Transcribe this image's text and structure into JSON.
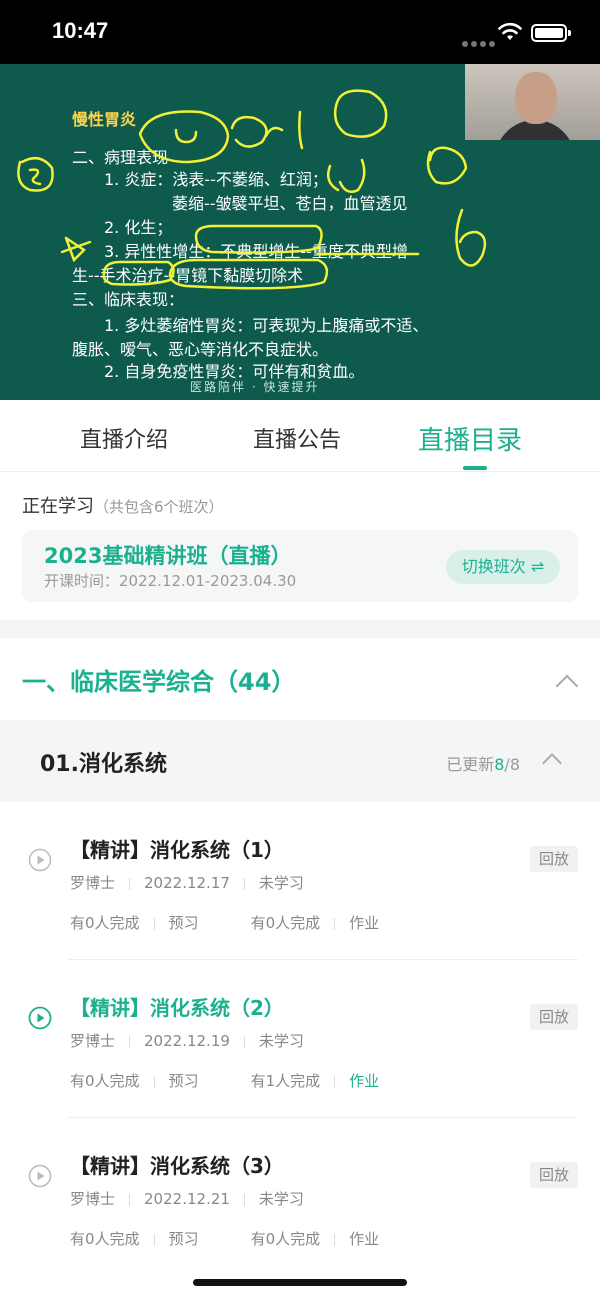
{
  "status_bar": {
    "time": "10:47"
  },
  "video": {
    "slide_title": "慢性胃炎",
    "lines": [
      "二、病理表现",
      "1. 炎症：浅表--不萎缩、红润；",
      "萎缩--皱襞平坦、苍白，血管透见",
      "2. 化生；",
      "3. 异性性增生：不典型增生--重度不典型增",
      "生--手术治疗--胃镜下黏膜切除术",
      "三、临床表现：",
      "1. 多灶萎缩性胃炎：可表现为上腹痛或不适、",
      "腹胀、嗳气、恶心等消化不良症状。",
      "2. 自身免疫性胃炎：可伴有和贫血。"
    ],
    "footer": "医路陪伴 · 快速提升"
  },
  "tabs": [
    {
      "label": "直播介绍"
    },
    {
      "label": "直播公告"
    },
    {
      "label": "直播目录"
    }
  ],
  "studying": {
    "label": "正在学习",
    "sub": "（共包含6个班次）",
    "class_name": "2023基础精讲班（直播）",
    "class_time": "开课时间：2022.12.01-2023.04.30",
    "switch_label": "切换班次 ⇌"
  },
  "chapter": {
    "title": "一、临床医学综合（44）"
  },
  "section": {
    "title": "01.消化系统",
    "updated_prefix": "已更新",
    "updated_count": "8",
    "updated_total": "/8"
  },
  "lessons": [
    {
      "title": "【精讲】消化系统（1）",
      "teacher": "罗博士",
      "date": "2022.12.17",
      "status": "未学习",
      "preview_count": "有0人完成",
      "preview_label": "预习",
      "hw_count": "有0人完成",
      "hw_label": "作业",
      "tag": "回放"
    },
    {
      "title": "【精讲】消化系统（2）",
      "teacher": "罗博士",
      "date": "2022.12.19",
      "status": "未学习",
      "preview_count": "有0人完成",
      "preview_label": "预习",
      "hw_count": "有1人完成",
      "hw_label": "作业",
      "tag": "回放"
    },
    {
      "title": "【精讲】消化系统（3）",
      "teacher": "罗博士",
      "date": "2022.12.21",
      "status": "未学习",
      "preview_count": "有0人完成",
      "preview_label": "预习",
      "hw_count": "有0人完成",
      "hw_label": "作业",
      "tag": "回放"
    }
  ],
  "colors": {
    "accent": "#1bb08e",
    "board": "#0e5b4d"
  }
}
